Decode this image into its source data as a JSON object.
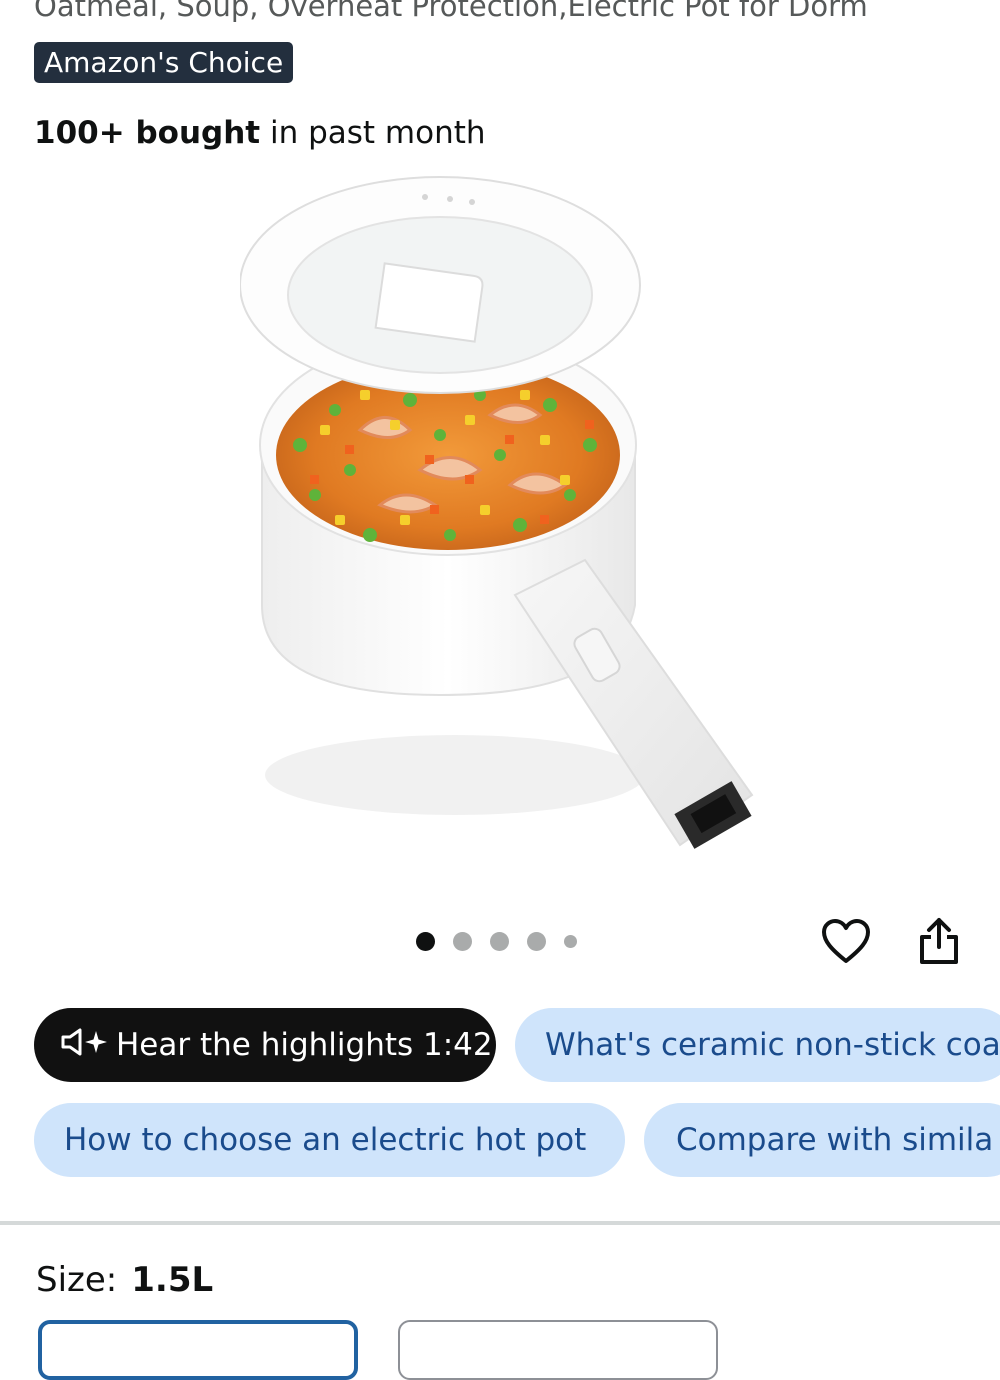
{
  "product": {
    "title_fragment": "Oatmeal, Soup, Overheat Protection,Electric Pot for Dorm",
    "badge": "Amazon's Choice",
    "bought_count": "100+ bought",
    "bought_suffix": " in past month"
  },
  "carousel": {
    "image_count": 5,
    "active_index": 0
  },
  "actions": {
    "favorite_icon": "heart-icon",
    "share_icon": "share-icon"
  },
  "chips": [
    {
      "label": "Hear the highlights 1:42",
      "style": "dark",
      "icon": "speaker-sparkle-icon"
    },
    {
      "label": "What's ceramic non-stick coa",
      "style": "light"
    },
    {
      "label": "How to choose an electric hot pot",
      "style": "light"
    },
    {
      "label": "Compare with simila",
      "style": "light"
    }
  ],
  "size": {
    "label": "Size:",
    "value": "1.5L"
  },
  "colors": {
    "badge_bg": "#232f3e",
    "chip_light_bg": "#cfe4fb",
    "chip_light_text": "#1a4b8c",
    "selected_border": "#2162a1"
  }
}
